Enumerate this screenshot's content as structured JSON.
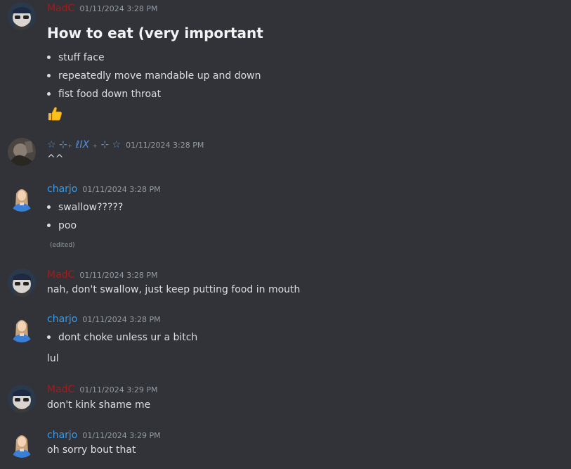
{
  "messages": [
    {
      "author": "MadC",
      "timestamp": "01/11/2024 3:28 PM",
      "heading": "How to eat (very important",
      "bullets": [
        "stuff face",
        "repeatedly move mandable up and down",
        "fist food down throat"
      ],
      "emoji": "thumbs-up"
    },
    {
      "author": "☆ ⊹₊ ℓΙX ₊ ⊹ ☆",
      "timestamp": "01/11/2024 3:28 PM",
      "text": "^^"
    },
    {
      "author": "charjo",
      "timestamp": "01/11/2024 3:28 PM",
      "bullets": [
        "swallow?????",
        "poo"
      ],
      "edited": "(edited)"
    },
    {
      "author": "MadC",
      "timestamp": "01/11/2024 3:28 PM",
      "text": "nah, don't swallow, just keep putting food in mouth"
    },
    {
      "author": "charjo",
      "timestamp": "01/11/2024 3:28 PM",
      "bullets": [
        "dont choke unless ur a bitch"
      ],
      "text": "lul"
    },
    {
      "author": "MadC",
      "timestamp": "01/11/2024 3:29 PM",
      "text": "don't kink shame me"
    },
    {
      "author": "charjo",
      "timestamp": "01/11/2024 3:29 PM",
      "text": "oh sorry bout that"
    }
  ],
  "colors": {
    "background": "#313338",
    "madc_name": "#a41b1b",
    "charjo_name": "#3a9be8",
    "elix_name": "#4d8fe0",
    "timestamp": "#949ba4",
    "text": "#dbdee1"
  }
}
